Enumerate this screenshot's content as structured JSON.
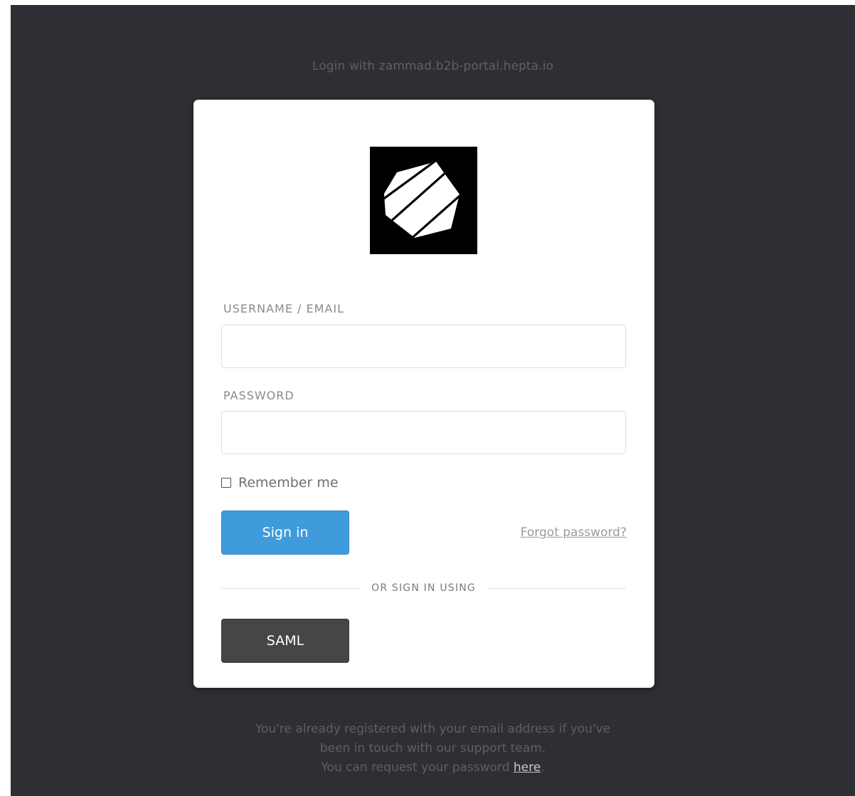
{
  "header": {
    "login_text": "Login with zammad.b2b-portal.hepta.io"
  },
  "logo": {
    "icon": "heptagon-logo-icon",
    "background": "#000000"
  },
  "form": {
    "username_label": "USERNAME / EMAIL",
    "username_value": "",
    "password_label": "PASSWORD",
    "password_value": "",
    "remember_label": "Remember me",
    "remember_checked": false,
    "signin_label": "Sign in",
    "forgot_label": "Forgot password?",
    "separator_label": "OR SIGN IN USING",
    "saml_label": "SAML"
  },
  "footer": {
    "line1": "You're already registered with your email address if you've",
    "line2": "been in touch with our support team.",
    "line3_prefix": "You can request your password ",
    "line3_link": "here",
    "line3_suffix": "."
  },
  "colors": {
    "page_background": "#2e2e35",
    "card_background": "#ffffff",
    "signin_button": "#3f9bdc",
    "saml_button": "#464646"
  }
}
